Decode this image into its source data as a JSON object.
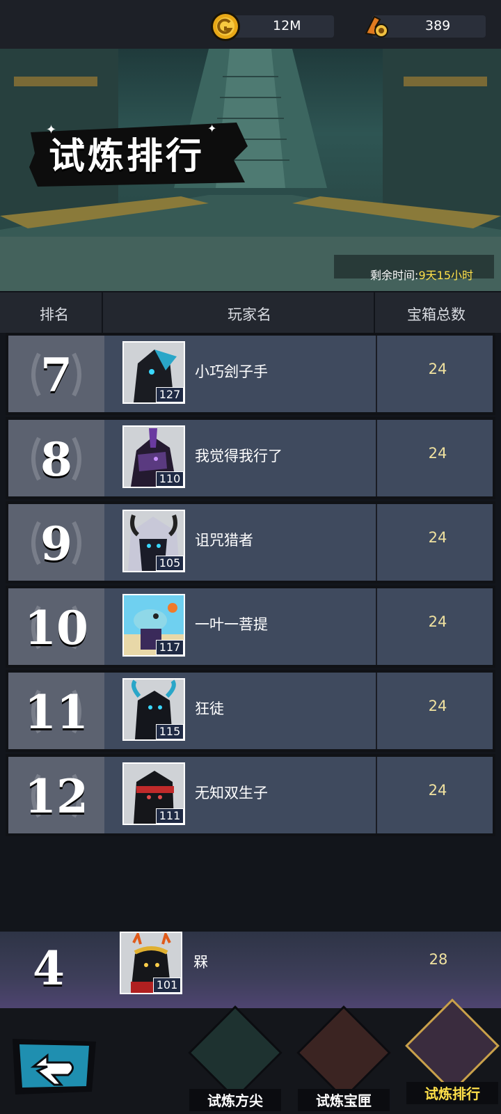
{
  "currency": {
    "gold": {
      "icon": "gold-coin-icon",
      "value": "12M"
    },
    "gem": {
      "icon": "trophy-key-icon",
      "value": "389"
    }
  },
  "banner": {
    "title": "试炼排行",
    "remaining_label": "剩余时间:",
    "remaining_value": "9天15小时"
  },
  "table": {
    "headers": {
      "rank": "排名",
      "player": "玩家名",
      "total": "宝箱总数"
    },
    "rows": [
      {
        "rank": "7",
        "name": "小巧刽子手",
        "level": "127",
        "score": "24",
        "avatar": "dark-armored-knight-avatar"
      },
      {
        "rank": "8",
        "name": "我觉得我行了",
        "level": "110",
        "score": "24",
        "avatar": "purple-crested-warrior-avatar"
      },
      {
        "rank": "9",
        "name": "诅咒猎者",
        "level": "105",
        "score": "24",
        "avatar": "horned-white-haired-avatar"
      },
      {
        "rank": "10",
        "name": "一叶一菩提",
        "level": "117",
        "score": "24",
        "avatar": "blue-dinosaur-avatar"
      },
      {
        "rank": "11",
        "name": "狂徒",
        "level": "115",
        "score": "24",
        "avatar": "blue-horned-demon-avatar"
      },
      {
        "rank": "12",
        "name": "无知双生子",
        "level": "111",
        "score": "24",
        "avatar": "red-headband-ninja-avatar"
      }
    ]
  },
  "my_rank": {
    "rank": "4",
    "name": "槑",
    "level": "101",
    "score": "28",
    "avatar": "monkey-king-avatar"
  },
  "nav": {
    "back": "back-arrow-icon",
    "items": [
      {
        "label": "试炼方尖",
        "icon": "obelisk-icon"
      },
      {
        "label": "试炼宝匣",
        "icon": "treasure-chest-icon"
      },
      {
        "label": "试炼排行",
        "icon": "throne-icon",
        "active": true
      }
    ]
  }
}
